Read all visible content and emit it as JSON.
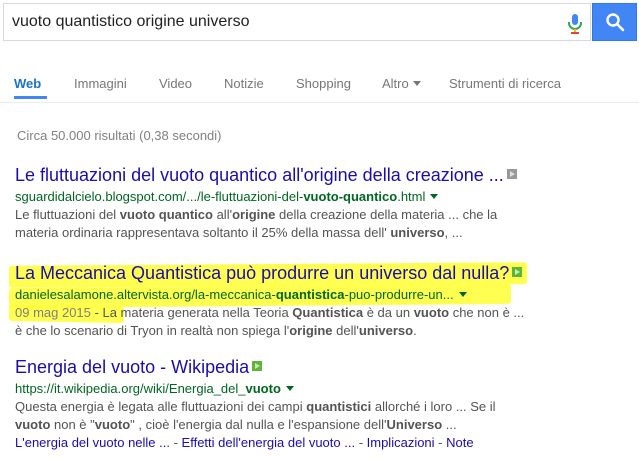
{
  "search": {
    "query": "vuoto quantistico origine universo"
  },
  "tabs": [
    {
      "label": "Web"
    },
    {
      "label": "Immagini"
    },
    {
      "label": "Video"
    },
    {
      "label": "Notizie"
    },
    {
      "label": "Shopping"
    },
    {
      "label": "Altro"
    },
    {
      "label": "Strumenti di ricerca"
    }
  ],
  "stats": "Circa 50.000 risultati (0,38 secondi)",
  "results": [
    {
      "title": "Le fluttuazioni del vuoto quantico all'origine della creazione ...",
      "url_pre": "sguardidalcielo.blogspot.com/.../le-fluttuazioni-del-",
      "url_bold": "vuoto-quantico",
      "url_post": ".html",
      "snippet_1a": "Le fluttuazioni del ",
      "snippet_1b": "vuoto quantico",
      "snippet_1c": " all'",
      "snippet_1d": "origine",
      "snippet_1e": " della creazione della materia ... che la",
      "snippet_2a": "materia ordinaria rappresentava soltanto il 25% della massa dell' ",
      "snippet_2b": "universo",
      "snippet_2c": ",  ..."
    },
    {
      "title": "La Meccanica Quantistica può produrre un universo dal nulla?",
      "url_pre": "danielesalamone.altervista.org/la-meccanica-",
      "url_bold": "quantistica",
      "url_post": "-puo-produrre-un...",
      "date": "09 mag 2015",
      "snippet_1a": " - La materia generata nella Teoria ",
      "snippet_1b": "Quantistica",
      "snippet_1c": " è da un ",
      "snippet_1d": "vuoto",
      "snippet_1e": " che non è ...",
      "snippet_2a": "è che lo scenario di Tryon in realtà non spiega l'",
      "snippet_2b": "origine",
      "snippet_2c": " dell'",
      "snippet_2d": "universo",
      "snippet_2e": "."
    },
    {
      "title": "Energia del vuoto - Wikipedia",
      "url_pre": "https://it.wikipedia.org/wiki/Energia_del_",
      "url_bold": "vuoto",
      "snippet_1a": "Questa energia è legata alle fluttuazioni dei campi ",
      "snippet_1b": "quantistici",
      "snippet_1c": " allorché i loro ... Se il",
      "snippet_2a": "vuoto",
      "snippet_2b": " non è \"",
      "snippet_2c": "vuoto",
      "snippet_2d": "\" , cioè l'energia dal nulla e l'espansione dell'",
      "snippet_2e": "Universo",
      "snippet_2f": "  ...",
      "sitelinks": [
        "L'energia del vuoto nelle ...",
        "Effetti dell'energia del vuoto ...",
        "Implicazioni",
        "Note"
      ]
    }
  ],
  "colors": {
    "accent": "#4285f4",
    "title_link": "#1a0dab",
    "url_green": "#006621",
    "highlight": "#ffff33"
  },
  "icons": [
    "mic-icon",
    "search-icon",
    "external-icon",
    "dropdown-caret-icon"
  ]
}
